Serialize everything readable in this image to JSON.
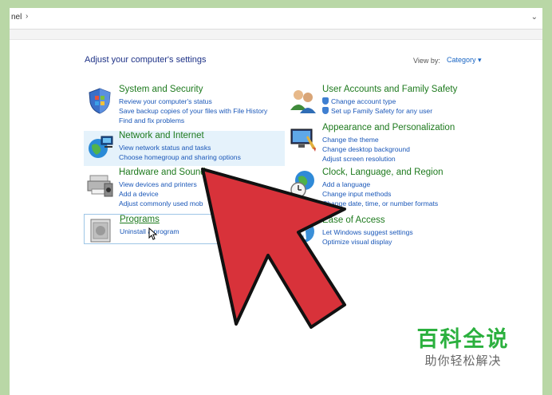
{
  "address": {
    "path_fragment": "nel",
    "chevron": "›",
    "dropdown": "⌄"
  },
  "page": {
    "title": "Adjust your computer's settings",
    "view_by_label": "View by:",
    "view_by_value": "Category ▾"
  },
  "categories": [
    {
      "title": "System and Security",
      "links": [
        "Review your computer's status",
        "Save backup copies of your files with File History",
        "Find and fix problems"
      ],
      "icon": "shield-flag-icon"
    },
    {
      "title": "Network and Internet",
      "links": [
        "View network status and tasks",
        "Choose homegroup and sharing options"
      ],
      "icon": "globe-network-icon"
    },
    {
      "title": "Hardware and Sound",
      "links": [
        "View devices and printers",
        "Add a device",
        "Adjust commonly used mob"
      ],
      "icon": "printer-icon"
    },
    {
      "title": "Programs",
      "links": [
        "Uninstall a program"
      ],
      "icon": "programs-icon"
    },
    {
      "title": "User Accounts and Family Safety",
      "links": [
        "Change account type",
        "Set up Family Safety for any user"
      ],
      "icon": "users-icon"
    },
    {
      "title": "Appearance and Personalization",
      "links": [
        "Change the theme",
        "Change desktop background",
        "Adjust screen resolution"
      ],
      "icon": "monitor-icon"
    },
    {
      "title": "Clock, Language, and Region",
      "links": [
        "Add a language",
        "Change input methods",
        "Change date, time, or number formats"
      ],
      "icon": "clock-globe-icon"
    },
    {
      "title": "Ease of Access",
      "links": [
        "Let Windows suggest settings",
        "Optimize visual display"
      ],
      "icon": "ease-of-access-icon"
    }
  ],
  "watermark": {
    "main": "百科全说",
    "sub": "助你轻松解决"
  },
  "colors": {
    "arrow": "#d8323a",
    "arrow_outline": "#111111",
    "title_green": "#1e7a1e",
    "link_blue": "#1a57b8",
    "heading_blue": "#1e3287",
    "frame_green": "#b9d7a6"
  }
}
